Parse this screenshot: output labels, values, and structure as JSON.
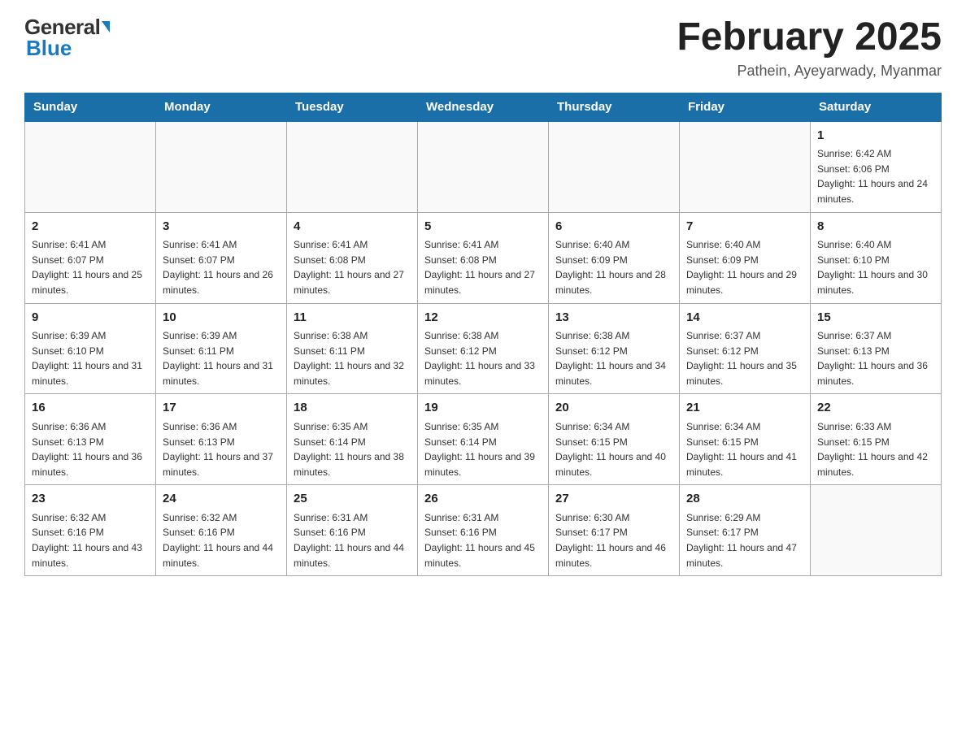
{
  "header": {
    "logo_general": "General",
    "logo_blue": "Blue",
    "month_title": "February 2025",
    "location": "Pathein, Ayeyarwady, Myanmar"
  },
  "days_of_week": [
    "Sunday",
    "Monday",
    "Tuesday",
    "Wednesday",
    "Thursday",
    "Friday",
    "Saturday"
  ],
  "weeks": [
    [
      {
        "day": "",
        "info": ""
      },
      {
        "day": "",
        "info": ""
      },
      {
        "day": "",
        "info": ""
      },
      {
        "day": "",
        "info": ""
      },
      {
        "day": "",
        "info": ""
      },
      {
        "day": "",
        "info": ""
      },
      {
        "day": "1",
        "info": "Sunrise: 6:42 AM\nSunset: 6:06 PM\nDaylight: 11 hours and 24 minutes."
      }
    ],
    [
      {
        "day": "2",
        "info": "Sunrise: 6:41 AM\nSunset: 6:07 PM\nDaylight: 11 hours and 25 minutes."
      },
      {
        "day": "3",
        "info": "Sunrise: 6:41 AM\nSunset: 6:07 PM\nDaylight: 11 hours and 26 minutes."
      },
      {
        "day": "4",
        "info": "Sunrise: 6:41 AM\nSunset: 6:08 PM\nDaylight: 11 hours and 27 minutes."
      },
      {
        "day": "5",
        "info": "Sunrise: 6:41 AM\nSunset: 6:08 PM\nDaylight: 11 hours and 27 minutes."
      },
      {
        "day": "6",
        "info": "Sunrise: 6:40 AM\nSunset: 6:09 PM\nDaylight: 11 hours and 28 minutes."
      },
      {
        "day": "7",
        "info": "Sunrise: 6:40 AM\nSunset: 6:09 PM\nDaylight: 11 hours and 29 minutes."
      },
      {
        "day": "8",
        "info": "Sunrise: 6:40 AM\nSunset: 6:10 PM\nDaylight: 11 hours and 30 minutes."
      }
    ],
    [
      {
        "day": "9",
        "info": "Sunrise: 6:39 AM\nSunset: 6:10 PM\nDaylight: 11 hours and 31 minutes."
      },
      {
        "day": "10",
        "info": "Sunrise: 6:39 AM\nSunset: 6:11 PM\nDaylight: 11 hours and 31 minutes."
      },
      {
        "day": "11",
        "info": "Sunrise: 6:38 AM\nSunset: 6:11 PM\nDaylight: 11 hours and 32 minutes."
      },
      {
        "day": "12",
        "info": "Sunrise: 6:38 AM\nSunset: 6:12 PM\nDaylight: 11 hours and 33 minutes."
      },
      {
        "day": "13",
        "info": "Sunrise: 6:38 AM\nSunset: 6:12 PM\nDaylight: 11 hours and 34 minutes."
      },
      {
        "day": "14",
        "info": "Sunrise: 6:37 AM\nSunset: 6:12 PM\nDaylight: 11 hours and 35 minutes."
      },
      {
        "day": "15",
        "info": "Sunrise: 6:37 AM\nSunset: 6:13 PM\nDaylight: 11 hours and 36 minutes."
      }
    ],
    [
      {
        "day": "16",
        "info": "Sunrise: 6:36 AM\nSunset: 6:13 PM\nDaylight: 11 hours and 36 minutes."
      },
      {
        "day": "17",
        "info": "Sunrise: 6:36 AM\nSunset: 6:13 PM\nDaylight: 11 hours and 37 minutes."
      },
      {
        "day": "18",
        "info": "Sunrise: 6:35 AM\nSunset: 6:14 PM\nDaylight: 11 hours and 38 minutes."
      },
      {
        "day": "19",
        "info": "Sunrise: 6:35 AM\nSunset: 6:14 PM\nDaylight: 11 hours and 39 minutes."
      },
      {
        "day": "20",
        "info": "Sunrise: 6:34 AM\nSunset: 6:15 PM\nDaylight: 11 hours and 40 minutes."
      },
      {
        "day": "21",
        "info": "Sunrise: 6:34 AM\nSunset: 6:15 PM\nDaylight: 11 hours and 41 minutes."
      },
      {
        "day": "22",
        "info": "Sunrise: 6:33 AM\nSunset: 6:15 PM\nDaylight: 11 hours and 42 minutes."
      }
    ],
    [
      {
        "day": "23",
        "info": "Sunrise: 6:32 AM\nSunset: 6:16 PM\nDaylight: 11 hours and 43 minutes."
      },
      {
        "day": "24",
        "info": "Sunrise: 6:32 AM\nSunset: 6:16 PM\nDaylight: 11 hours and 44 minutes."
      },
      {
        "day": "25",
        "info": "Sunrise: 6:31 AM\nSunset: 6:16 PM\nDaylight: 11 hours and 44 minutes."
      },
      {
        "day": "26",
        "info": "Sunrise: 6:31 AM\nSunset: 6:16 PM\nDaylight: 11 hours and 45 minutes."
      },
      {
        "day": "27",
        "info": "Sunrise: 6:30 AM\nSunset: 6:17 PM\nDaylight: 11 hours and 46 minutes."
      },
      {
        "day": "28",
        "info": "Sunrise: 6:29 AM\nSunset: 6:17 PM\nDaylight: 11 hours and 47 minutes."
      },
      {
        "day": "",
        "info": ""
      }
    ]
  ]
}
